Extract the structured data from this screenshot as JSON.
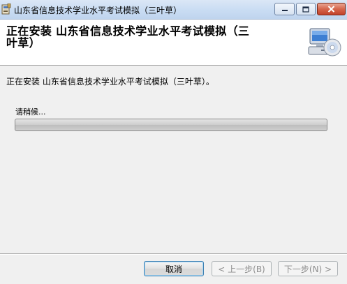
{
  "window": {
    "title": "山东省信息技术学业水平考试模拟（三叶草）",
    "icons": {
      "app": "installer-app-icon",
      "minimize": "minimize-icon",
      "maximize": "maximize-icon",
      "close": "close-icon"
    }
  },
  "header": {
    "title": "正在安装 山东省信息技术学业水平考试模拟（三叶草）",
    "icon": "computer-cd-icon"
  },
  "body": {
    "status": "正在安装 山东省信息技术学业水平考试模拟（三叶草）。",
    "wait_label": "请稍候...",
    "progress": 0
  },
  "footer": {
    "cancel_label": "取消",
    "back_label": "< 上一步(B)",
    "next_label": "下一步(N) >"
  }
}
